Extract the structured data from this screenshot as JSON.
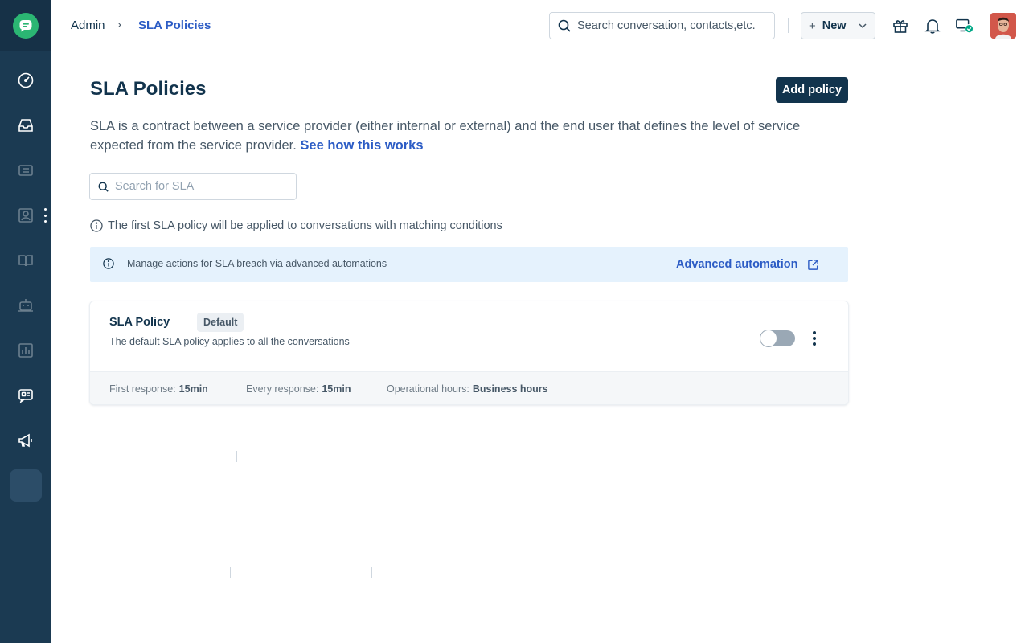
{
  "colors": {
    "sidebar_bg": "#1b3a52",
    "brand_green": "#2bb673",
    "primary_text": "#12344d",
    "link_blue": "#2c5cc5",
    "banner_bg": "#e5f2fd",
    "status_green": "#00a886"
  },
  "header": {
    "breadcrumb_parent": "Admin",
    "breadcrumb_separator": "›",
    "breadcrumb_current": "SLA Policies",
    "search_placeholder": "Search conversation, contacts,etc.",
    "new_button_label": "New"
  },
  "sidebar": {
    "icons": [
      "dashboard-icon",
      "inbox-icon",
      "tickets-icon",
      "contacts-icon",
      "knowledge-base-icon",
      "bot-icon",
      "reports-icon",
      "chat-icon",
      "campaigns-icon",
      "admin-icon"
    ]
  },
  "page": {
    "title": "SLA Policies",
    "add_button_label": "Add policy",
    "description": "SLA is a contract between a service provider (either internal or external) and the end user that defines the level of service expected from the service provider.",
    "description_link": "See how this works",
    "search_placeholder": "Search for SLA",
    "info_text": "The first SLA policy will be applied to conversations with matching conditions"
  },
  "banner": {
    "text": "Manage actions for SLA breach via advanced automations",
    "link_label": "Advanced automation"
  },
  "policy": {
    "name": "SLA Policy",
    "badge": "Default",
    "description": "The default SLA policy applies to all the conversations",
    "enabled": false,
    "first_response_label": "First response:",
    "first_response_value": "15min",
    "every_response_label": "Every response:",
    "every_response_value": "15min",
    "operational_hours_label": "Operational hours:",
    "operational_hours_value": "Business hours"
  }
}
